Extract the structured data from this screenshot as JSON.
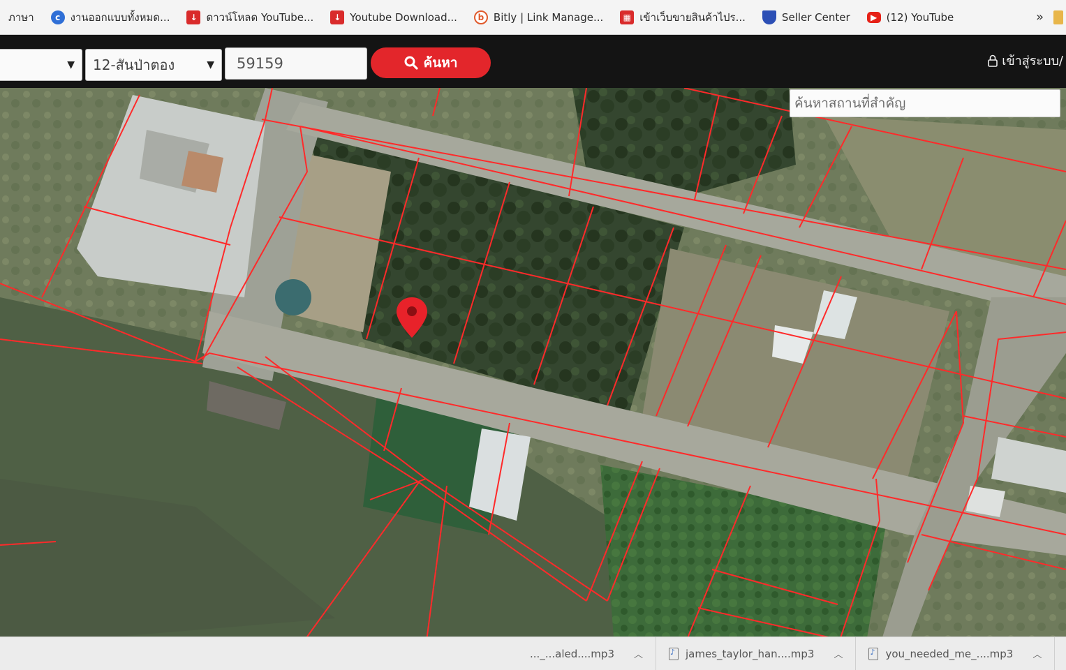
{
  "bookmarks": {
    "items": [
      {
        "label": "ภาษา",
        "icon": "none"
      },
      {
        "label": "งานออกแบบทั้งหมด...",
        "icon": "c-icon"
      },
      {
        "label": "ดาวน์โหลด YouTube...",
        "icon": "download-icon"
      },
      {
        "label": "Youtube Download...",
        "icon": "download-icon"
      },
      {
        "label": "Bitly | Link Manage...",
        "icon": "bitly-icon"
      },
      {
        "label": "เข้าเว็บขายสินค้าไปร...",
        "icon": "shop-icon"
      },
      {
        "label": "Seller Center",
        "icon": "shield-icon"
      },
      {
        "label": "(12) YouTube",
        "icon": "youtube-icon"
      }
    ],
    "more": "»"
  },
  "search": {
    "province_value": "",
    "district_value": "12-สันป่าตอง",
    "parcel_value": "59159",
    "button_label": "ค้นหา",
    "login_label": "เข้าสู่ระบบ/"
  },
  "map": {
    "place_search_placeholder": "ค้นหาสถานที่สำคัญ",
    "boundary_color": "#ff2a2a",
    "marker_color": "#e8222a"
  },
  "downloads": {
    "items": [
      {
        "label": "..._...aled....mp3"
      },
      {
        "label": "james_taylor_han....mp3"
      },
      {
        "label": "you_needed_me_....mp3"
      }
    ]
  },
  "colors": {
    "accent": "#e3262b",
    "toolbar_bg": "#141414"
  }
}
